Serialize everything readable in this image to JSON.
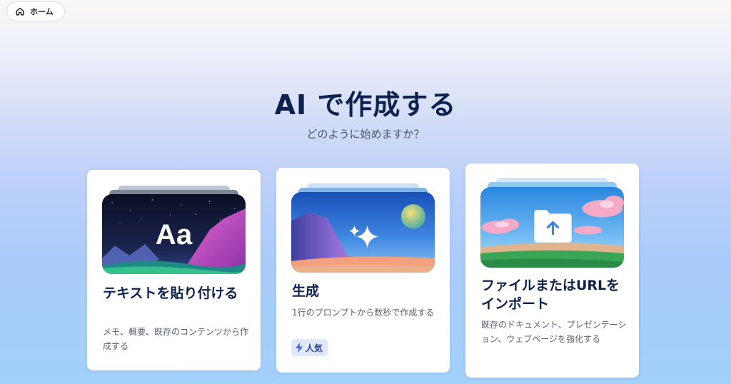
{
  "nav": {
    "home_label": "ホーム",
    "home_icon": "home-icon"
  },
  "header": {
    "title": "AI で作成する",
    "subtitle": "どのように始めますか？"
  },
  "cards": [
    {
      "title": "テキストを貼り付ける",
      "description": "メモ、概要、既存のコンテンツから作成する",
      "thumbnail_text": "Aa"
    },
    {
      "title": "生成",
      "description": "1行のプロンプトから数秒で作成する",
      "badge": "人気",
      "badge_icon": "lightning-icon",
      "thumbnail_icon": "sparkle-icon"
    },
    {
      "title": "ファイルまたはURLをインポート",
      "description": "既存のドキュメント、プレゼンテーション、ウェブページを強化する",
      "thumbnail_icon": "folder-upload-icon"
    }
  ],
  "colors": {
    "title": "#0c2150",
    "badge_bg": "#dfe8fc",
    "badge_text": "#24439a"
  }
}
